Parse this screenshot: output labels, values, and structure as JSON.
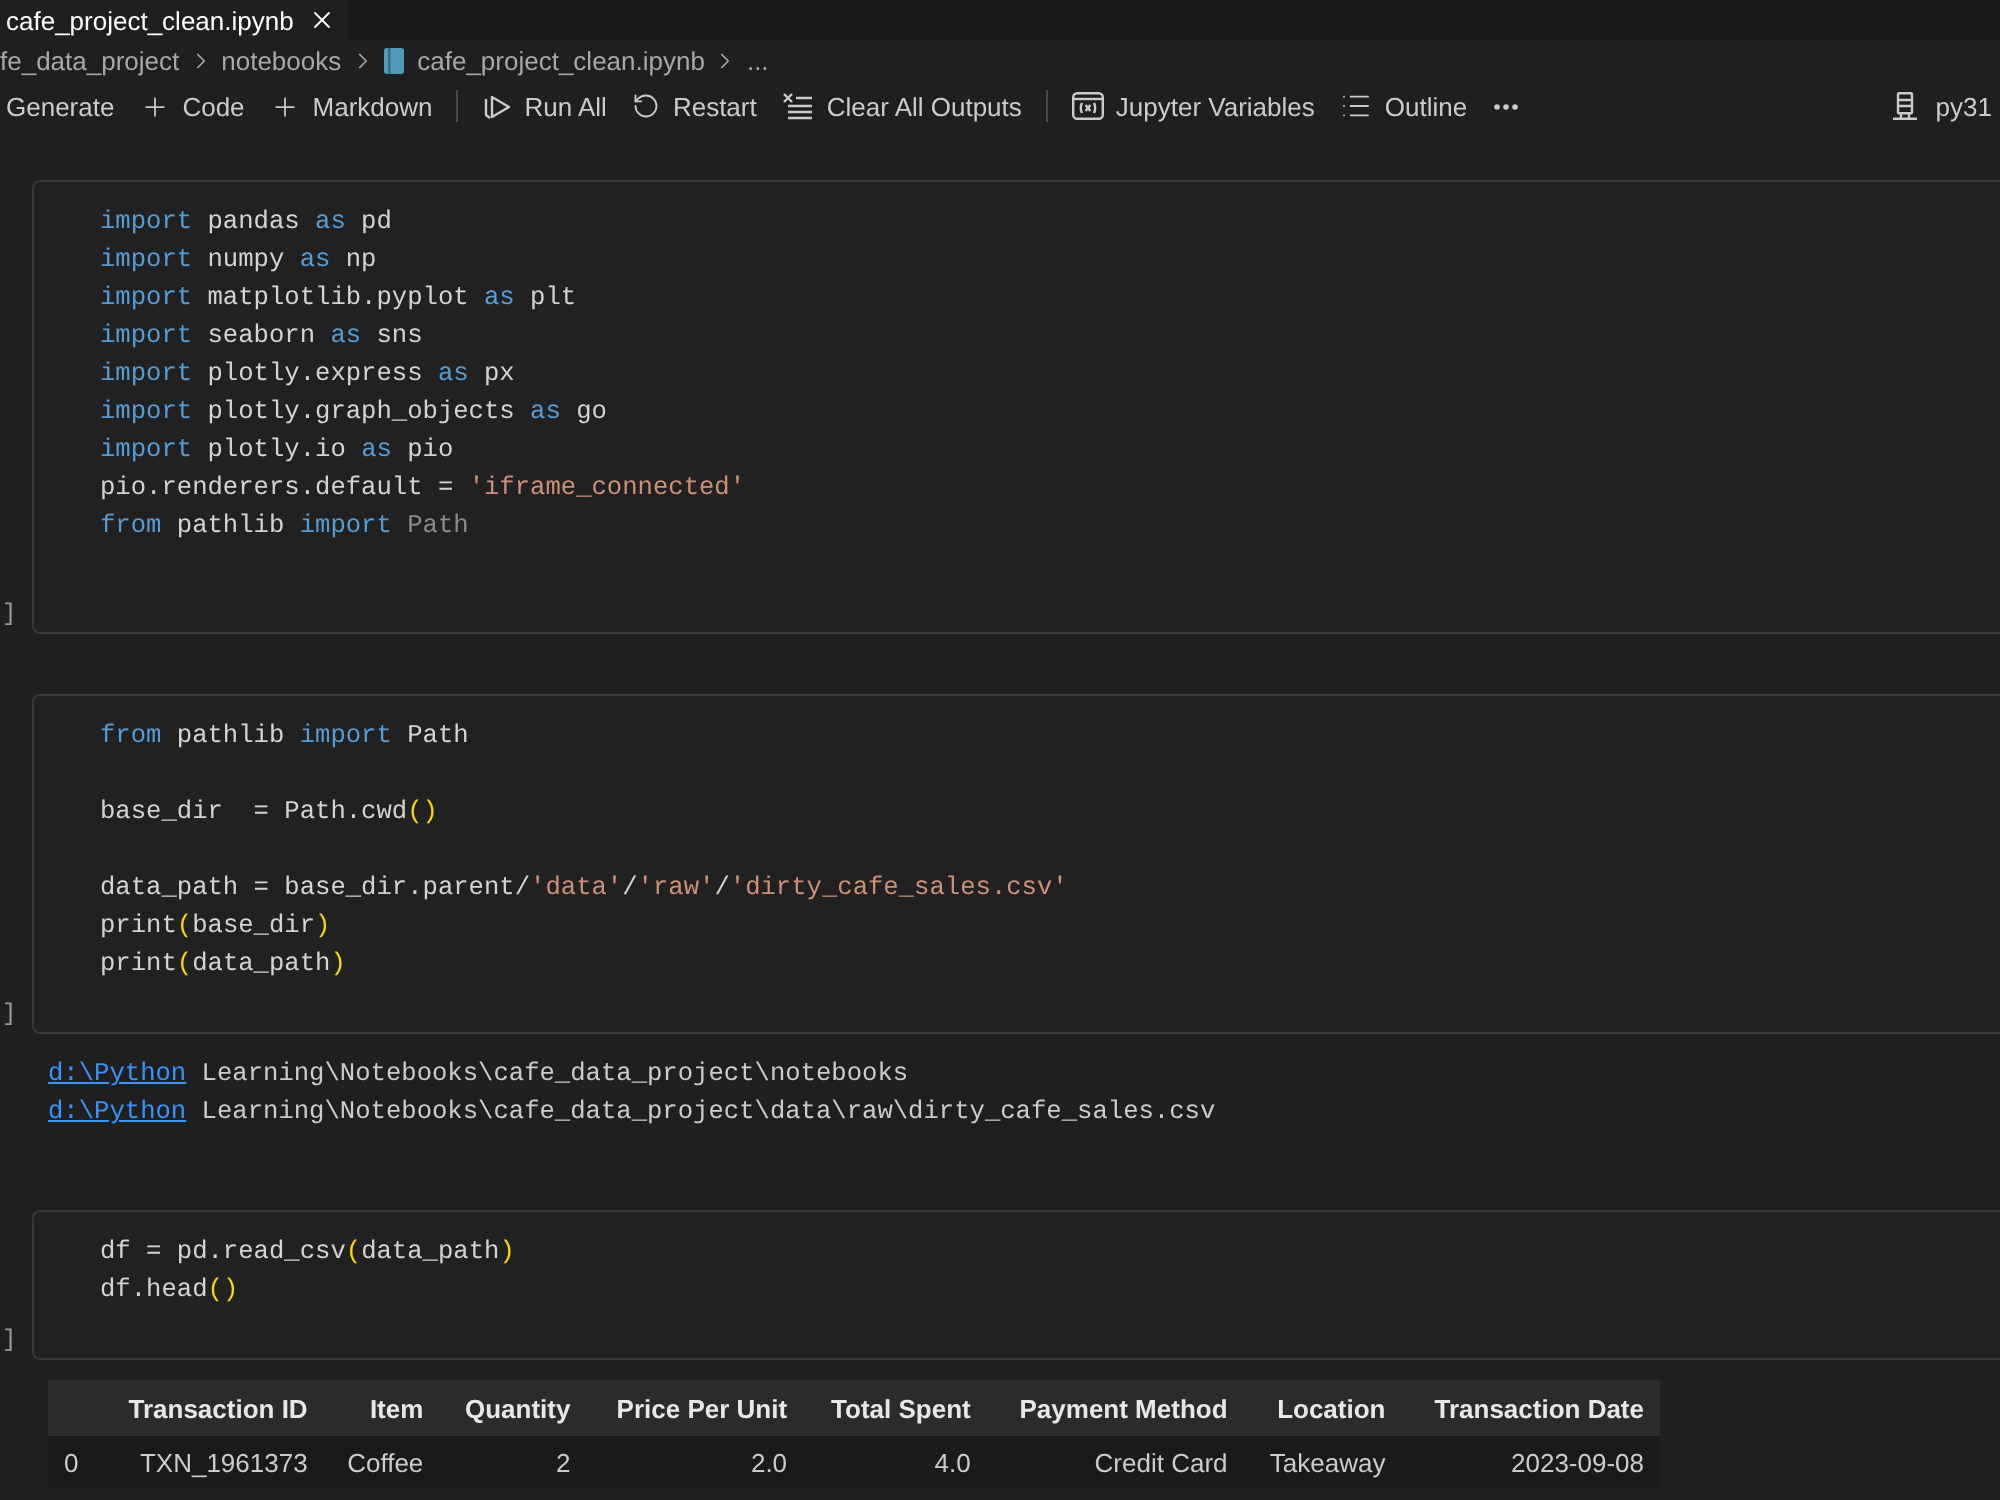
{
  "tab": {
    "title": "cafe_project_clean.ipynb",
    "selected": true
  },
  "breadcrumb": [
    {
      "label": "fe_data_project",
      "kind": "folder"
    },
    {
      "label": "notebooks",
      "kind": "folder"
    },
    {
      "label": "cafe_project_clean.ipynb",
      "kind": "notebook"
    },
    {
      "label": "...",
      "kind": "more"
    }
  ],
  "toolbar": {
    "groups": [
      [
        {
          "label": "Generate",
          "kind": "text"
        },
        {
          "label": "Code",
          "kind": "add"
        },
        {
          "label": "Markdown",
          "kind": "add"
        }
      ],
      [
        {
          "label": "Run All",
          "kind": "run_all"
        },
        {
          "label": "Restart",
          "kind": "restart"
        },
        {
          "label": "Clear All Outputs",
          "kind": "clear"
        }
      ],
      [
        {
          "label": "Jupyter Variables",
          "kind": "variables"
        },
        {
          "label": "Outline",
          "kind": "outline"
        },
        {
          "kind": "more"
        }
      ]
    ],
    "kernel": {
      "label": "py31"
    }
  },
  "cells": [
    {
      "execution_label": "]",
      "lines": [
        {
          "kind": "code",
          "tokens": [
            {
              "kind": "keyword",
              "text": "import"
            },
            {
              "kind": "plain",
              "text": " pandas "
            },
            {
              "kind": "keyword",
              "text": "as"
            },
            {
              "kind": "plain",
              "text": " pd"
            }
          ]
        },
        {
          "kind": "code",
          "tokens": [
            {
              "kind": "keyword",
              "text": "import"
            },
            {
              "kind": "plain",
              "text": " numpy "
            },
            {
              "kind": "keyword",
              "text": "as"
            },
            {
              "kind": "plain",
              "text": " np"
            }
          ]
        },
        {
          "kind": "code",
          "tokens": [
            {
              "kind": "keyword",
              "text": "import"
            },
            {
              "kind": "plain",
              "text": " matplotlib.pyplot "
            },
            {
              "kind": "keyword",
              "text": "as"
            },
            {
              "kind": "plain",
              "text": " plt"
            }
          ]
        },
        {
          "kind": "code",
          "tokens": [
            {
              "kind": "keyword",
              "text": "import"
            },
            {
              "kind": "plain",
              "text": " seaborn "
            },
            {
              "kind": "keyword",
              "text": "as"
            },
            {
              "kind": "plain",
              "text": " sns"
            }
          ]
        },
        {
          "kind": "code",
          "tokens": [
            {
              "kind": "keyword",
              "text": "import"
            },
            {
              "kind": "plain",
              "text": " plotly.express "
            },
            {
              "kind": "keyword",
              "text": "as"
            },
            {
              "kind": "plain",
              "text": " px"
            }
          ]
        },
        {
          "kind": "code",
          "tokens": [
            {
              "kind": "keyword",
              "text": "import"
            },
            {
              "kind": "plain",
              "text": " plotly.graph_objects "
            },
            {
              "kind": "keyword",
              "text": "as"
            },
            {
              "kind": "plain",
              "text": " go"
            }
          ]
        },
        {
          "kind": "code",
          "tokens": [
            {
              "kind": "keyword",
              "text": "import"
            },
            {
              "kind": "plain",
              "text": " plotly.io "
            },
            {
              "kind": "keyword",
              "text": "as"
            },
            {
              "kind": "plain",
              "text": " pio"
            }
          ]
        },
        {
          "kind": "code",
          "tokens": [
            {
              "kind": "plain",
              "text": "pio.renderers.default = "
            },
            {
              "kind": "string",
              "text": "'iframe_connected'"
            }
          ]
        },
        {
          "kind": "code",
          "tokens": [
            {
              "kind": "keyword",
              "text": "from"
            },
            {
              "kind": "plain",
              "text": " pathlib "
            },
            {
              "kind": "keyword",
              "text": "import "
            },
            {
              "kind": "dimmed",
              "text": "Path"
            }
          ]
        },
        {
          "kind": "blank"
        }
      ]
    },
    {
      "execution_label": "]",
      "lines": [
        {
          "kind": "code",
          "tokens": [
            {
              "kind": "keyword",
              "text": "from"
            },
            {
              "kind": "plain",
              "text": " pathlib "
            },
            {
              "kind": "keyword",
              "text": "import"
            },
            {
              "kind": "plain",
              "text": " Path"
            }
          ]
        },
        {
          "kind": "blank"
        },
        {
          "kind": "code",
          "tokens": [
            {
              "kind": "plain",
              "text": "base_dir  = Path.cwd"
            },
            {
              "kind": "bracket",
              "text": "()"
            }
          ]
        },
        {
          "kind": "blank"
        },
        {
          "kind": "code",
          "tokens": [
            {
              "kind": "plain",
              "text": "data_path = base_dir.parent/"
            },
            {
              "kind": "string",
              "text": "'data'"
            },
            {
              "kind": "plain",
              "text": "/"
            },
            {
              "kind": "string",
              "text": "'raw'"
            },
            {
              "kind": "plain",
              "text": "/"
            },
            {
              "kind": "string",
              "text": "'dirty_cafe_sales.csv'"
            }
          ]
        },
        {
          "kind": "code",
          "tokens": [
            {
              "kind": "plain",
              "text": "print"
            },
            {
              "kind": "bracket",
              "text": "("
            },
            {
              "kind": "plain",
              "text": "base_dir"
            },
            {
              "kind": "bracket",
              "text": ")"
            }
          ]
        },
        {
          "kind": "code",
          "tokens": [
            {
              "kind": "plain",
              "text": "print"
            },
            {
              "kind": "bracket",
              "text": "("
            },
            {
              "kind": "plain",
              "text": "data_path"
            },
            {
              "kind": "bracket",
              "text": ")"
            }
          ]
        }
      ],
      "outputs": [
        {
          "link": "d:\\Python",
          "text": " Learning\\Notebooks\\cafe_data_project\\notebooks"
        },
        {
          "link": "d:\\Python",
          "text": " Learning\\Notebooks\\cafe_data_project\\data\\raw\\dirty_cafe_sales.csv"
        }
      ]
    },
    {
      "execution_label": "]",
      "lines": [
        {
          "kind": "code",
          "tokens": [
            {
              "kind": "plain",
              "text": "df = pd.read_csv"
            },
            {
              "kind": "bracket",
              "text": "("
            },
            {
              "kind": "plain",
              "text": "data_path"
            },
            {
              "kind": "bracket",
              "text": ")"
            }
          ]
        },
        {
          "kind": "code",
          "tokens": [
            {
              "kind": "plain",
              "text": "df.head"
            },
            {
              "kind": "bracket",
              "text": "()"
            }
          ]
        }
      ],
      "table": {
        "columns": [
          "Transaction ID",
          "Item",
          "Quantity",
          "Price Per Unit",
          "Total Spent",
          "Payment Method",
          "Location",
          "Transaction Date"
        ],
        "rows": [
          {
            "index": "0",
            "cells": [
              "TXN_1961373",
              "Coffee",
              "2",
              "2.0",
              "4.0",
              "Credit Card",
              "Takeaway",
              "2023-09-08"
            ]
          }
        ]
      }
    }
  ]
}
